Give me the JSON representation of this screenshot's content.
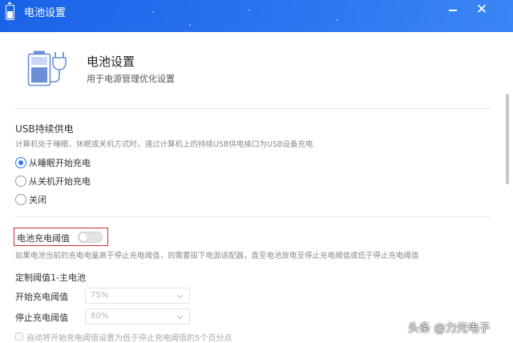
{
  "window": {
    "title": "电池设置"
  },
  "header": {
    "title": "电池设置",
    "subtitle": "用于电源管理优化设置"
  },
  "usb_section": {
    "title": "USB持续供电",
    "description": "计算机处于睡眠、休眠或关机方式时，通过计算机上的持续USB供电接口为USB设备充电",
    "options": [
      {
        "label": "从睡眠开始充电",
        "selected": true
      },
      {
        "label": "从关机开始充电",
        "selected": false
      },
      {
        "label": "关闭",
        "selected": false
      }
    ]
  },
  "threshold_section": {
    "label": "电池充电阈值",
    "enabled": false,
    "description": "如果电池当前的充电电量高于停止充电阈值，则需要拔下电源适配器，直至电池放电至停止充电阈值或低于停止充电阈值"
  },
  "custom_section": {
    "title": "定制阈值1-主电池",
    "start_label": "开始充电阈值",
    "start_value": "75%",
    "stop_label": "停止充电阈值",
    "stop_value": "80%",
    "checkbox_label": "自动将开始充电阈值设置为低于停止充电阈值的5个百分点",
    "checkbox_checked": false
  },
  "watermark": {
    "text": "头条 @力光电子"
  },
  "colors": {
    "titlebar": "#2a74f0",
    "accent": "#2f7cf6",
    "highlight_border": "#c9302c"
  },
  "icons": {
    "app": "battery-icon",
    "hero": "battery-plug-icon",
    "minimize": "minimize-icon",
    "close": "close-icon"
  }
}
